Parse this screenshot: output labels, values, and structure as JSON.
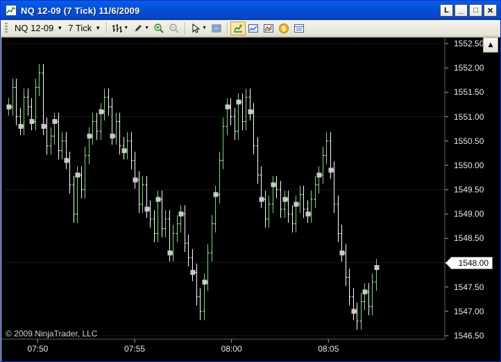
{
  "window": {
    "title": "NQ 12-09 (7 Tick)  11/6/2009",
    "buttons": {
      "help": "L",
      "minimize": "_",
      "maximize": "□",
      "close": "✕"
    }
  },
  "toolbar": {
    "instrument": "NQ 12-09",
    "period": "7 Tick",
    "icons": [
      "bar-type-icon",
      "draw-pencil-icon",
      "zoom-in-icon",
      "zoom-out-icon",
      "pointer-icon",
      "properties-icon",
      "strategy-icon",
      "chart-icon",
      "indicator-icon",
      "dollar-icon",
      "data-box-icon"
    ]
  },
  "chart": {
    "copyright": "© 2009 NinjaTrader, LLC",
    "current_price": "1548.00",
    "colors": {
      "background": "#000000",
      "bars": "#ffffff",
      "up_wick": "#7fdc7f",
      "marker": "#c8c8c8",
      "gridline": "#4a4a4a"
    }
  },
  "chart_data": {
    "type": "line",
    "instrument": "NQ 12-09",
    "ytick_labels": [
      "1552.50",
      "1552.00",
      "1551.50",
      "1551.00",
      "1550.50",
      "1550.00",
      "1549.50",
      "1549.00",
      "1548.50",
      "1547.50",
      "1547.00",
      "1546.50"
    ],
    "yticks": [
      1552.5,
      1552.0,
      1551.5,
      1551.0,
      1550.5,
      1550.0,
      1549.5,
      1549.0,
      1548.5,
      1548.0,
      1547.5,
      1547.0,
      1546.5
    ],
    "ylim": [
      1546.4,
      1552.6
    ],
    "xtick_labels": [
      "07:50",
      "07:55",
      "08:00",
      "08:05"
    ],
    "x_ticks_minutes": [
      470,
      475,
      480,
      485
    ],
    "xlim_minutes": [
      468.3,
      490.9
    ],
    "grid_levels": [
      1552.5,
      1551.0,
      1549.5,
      1548.0,
      1546.5
    ],
    "last_price": 1548.0,
    "series": [
      {
        "values": [
          1551.2,
          1551.6,
          1551.0,
          1550.8,
          1551.4,
          1551.2,
          1550.9,
          1551.6,
          1551.9,
          1550.8,
          1550.4,
          1550.6,
          1550.9,
          1550.3,
          1550.5,
          1550.1,
          1549.6,
          1549.0,
          1549.8,
          1549.5,
          1550.2,
          1550.6,
          1550.9,
          1550.7,
          1551.1,
          1551.4,
          1551.2,
          1550.6,
          1550.9,
          1550.4,
          1550.3,
          1550.5,
          1550.1,
          1549.7,
          1549.2,
          1549.6,
          1549.1,
          1548.9,
          1548.6,
          1549.3,
          1548.7,
          1548.9,
          1548.2,
          1548.6,
          1548.8,
          1549.0,
          1548.4,
          1548.1,
          1547.8,
          1547.3,
          1547.0,
          1547.6,
          1548.2,
          1548.8,
          1549.4,
          1550.1,
          1550.8,
          1551.2,
          1551.0,
          1550.7,
          1551.3,
          1550.9,
          1551.4,
          1551.1,
          1550.4,
          1549.8,
          1549.3,
          1548.9,
          1549.2,
          1549.6,
          1549.5,
          1549.1,
          1549.3,
          1549.0,
          1548.8,
          1549.2,
          1549.4,
          1549.1,
          1549.0,
          1549.3,
          1549.6,
          1549.8,
          1550.2,
          1550.5,
          1549.9,
          1549.2,
          1548.6,
          1548.2,
          1547.7,
          1547.3,
          1547.0,
          1546.8,
          1547.2,
          1547.4,
          1547.1,
          1547.6,
          1547.9
        ]
      }
    ]
  }
}
